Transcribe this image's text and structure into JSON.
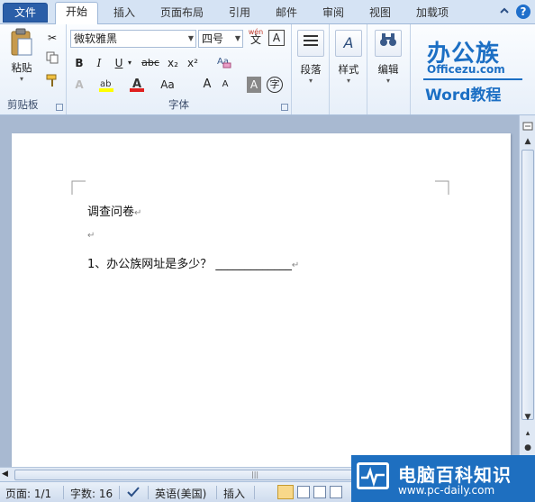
{
  "tabs": {
    "file": "文件",
    "home": "开始",
    "insert": "插入",
    "layout": "页面布局",
    "references": "引用",
    "mailings": "邮件",
    "review": "审阅",
    "view": "视图",
    "addins": "加载项"
  },
  "ribbon": {
    "clipboard": {
      "paste_label": "粘贴",
      "group_label": "剪贴板"
    },
    "font": {
      "font_name": "微软雅黑",
      "font_size": "四号",
      "group_label": "字体",
      "bold": "B",
      "italic": "I",
      "underline": "U",
      "strike": "abc",
      "subscript": "x₂",
      "superscript": "x²",
      "grow": "A",
      "shrink": "A",
      "case": "Aa",
      "wen_top": "wén",
      "wen_bottom": "文",
      "border_char": "A",
      "char_shade": "A",
      "enclose": "字"
    },
    "paragraph_label": "段落",
    "styles_label": "样式",
    "editing_label": "编辑"
  },
  "logo": {
    "main": "办公族",
    "sub": "Officezu.com",
    "word": "Word教程"
  },
  "document": {
    "line1": "调查问卷",
    "line3_prefix": "1、办公族网址是多少？",
    "line3_blank": "_____________"
  },
  "status": {
    "page": "页面: 1/1",
    "words": "字数: 16",
    "language": "英语(美国)",
    "mode": "插入"
  },
  "watermark": {
    "title": "电脑百科知识",
    "url": "www.pc-daily.com"
  }
}
